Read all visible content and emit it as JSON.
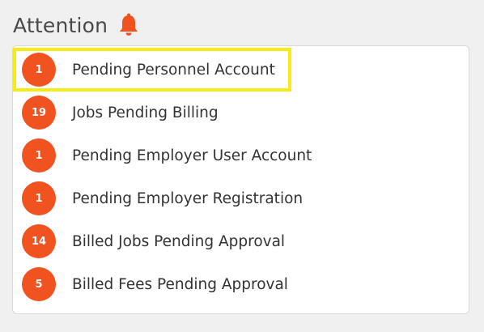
{
  "header": {
    "title": "Attention",
    "icon": "bell-icon"
  },
  "items": [
    {
      "count": "1",
      "label": "Pending Personnel Account"
    },
    {
      "count": "19",
      "label": "Jobs Pending Billing"
    },
    {
      "count": "1",
      "label": "Pending Employer User Account"
    },
    {
      "count": "1",
      "label": "Pending Employer Registration"
    },
    {
      "count": "14",
      "label": "Billed Jobs Pending Approval"
    },
    {
      "count": "5",
      "label": "Billed Fees Pending Approval"
    }
  ],
  "colors": {
    "badge": "#f0531f",
    "highlight": "#f5eb17"
  }
}
